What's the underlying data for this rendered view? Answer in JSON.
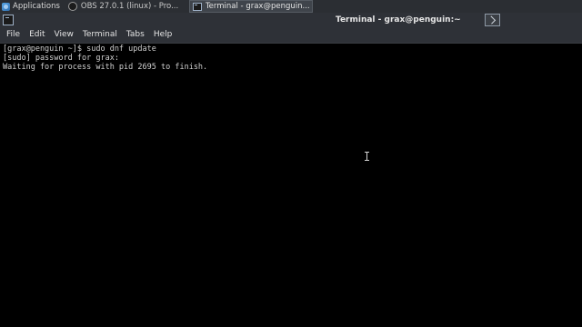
{
  "taskbar": {
    "applications_label": "Applications",
    "tasks": [
      {
        "label": "OBS 27.0.1 (linux) - Pro...",
        "icon": "obs-icon",
        "active": false
      },
      {
        "label": "Terminal - grax@penguin...",
        "icon": "terminal-icon",
        "active": true
      }
    ]
  },
  "window": {
    "title": "Terminal - grax@penguin:~",
    "icon": "terminal-icon"
  },
  "menubar": {
    "items": [
      "File",
      "Edit",
      "View",
      "Terminal",
      "Tabs",
      "Help"
    ]
  },
  "terminal": {
    "lines": [
      "[grax@penguin ~]$ sudo dnf update",
      "[sudo] password for grax:",
      "Waiting for process with pid 2695 to finish."
    ],
    "background": "#000000",
    "foreground": "#cfcfcf"
  },
  "colors": {
    "panel": "#2b2e33",
    "titlebar": "#2e3137",
    "active_task": "#3f444b"
  }
}
